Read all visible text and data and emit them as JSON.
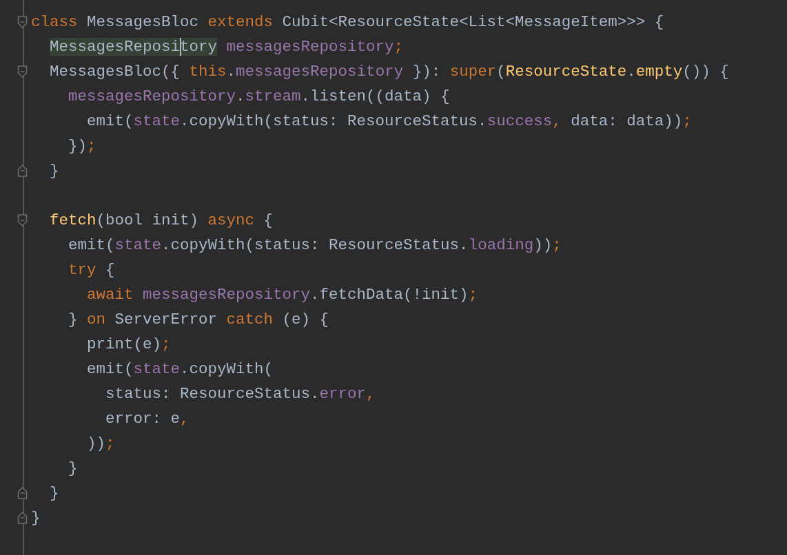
{
  "editor": {
    "lines": [
      {
        "kind": "fold-start",
        "tokens": [
          {
            "kind": "keyword",
            "text": "class"
          },
          {
            "kind": "plain",
            "text": " MessagesBloc "
          },
          {
            "kind": "keyword",
            "text": "extends"
          },
          {
            "kind": "plain",
            "text": " Cubit<ResourceState<List<MessageItem>>> {"
          }
        ]
      },
      {
        "kind": "code",
        "tokens": [
          {
            "kind": "plain",
            "text": "  MessagesReposi",
            "highlighted": true
          },
          {
            "kind": "plain",
            "text": "tory",
            "highlighted": true,
            "caret": true
          },
          {
            "kind": "field",
            "text": " messagesRepository"
          },
          {
            "kind": "keyword",
            "text": ";"
          }
        ]
      },
      {
        "kind": "fold-start",
        "tokens": [
          {
            "kind": "plain",
            "text": "  MessagesBloc({ "
          },
          {
            "kind": "keyword",
            "text": "this"
          },
          {
            "kind": "plain",
            "text": "."
          },
          {
            "kind": "field",
            "text": "messagesRepository"
          },
          {
            "kind": "plain",
            "text": " }): "
          },
          {
            "kind": "keyword",
            "text": "super"
          },
          {
            "kind": "plain",
            "text": "("
          },
          {
            "kind": "function",
            "text": "ResourceState"
          },
          {
            "kind": "plain",
            "text": "."
          },
          {
            "kind": "function",
            "text": "empty"
          },
          {
            "kind": "plain",
            "text": "()) {"
          }
        ]
      },
      {
        "kind": "code",
        "tokens": [
          {
            "kind": "field",
            "text": "    messagesRepository"
          },
          {
            "kind": "plain",
            "text": "."
          },
          {
            "kind": "field",
            "text": "stream"
          },
          {
            "kind": "plain",
            "text": ".listen((data) {"
          }
        ]
      },
      {
        "kind": "code",
        "tokens": [
          {
            "kind": "plain",
            "text": "      emit("
          },
          {
            "kind": "field",
            "text": "state"
          },
          {
            "kind": "plain",
            "text": ".copyWith(status: ResourceStatus."
          },
          {
            "kind": "field",
            "text": "success"
          },
          {
            "kind": "keyword",
            "text": ","
          },
          {
            "kind": "plain",
            "text": " data: data))"
          },
          {
            "kind": "keyword",
            "text": ";"
          }
        ]
      },
      {
        "kind": "code",
        "tokens": [
          {
            "kind": "plain",
            "text": "    })"
          },
          {
            "kind": "keyword",
            "text": ";"
          }
        ]
      },
      {
        "kind": "fold-end",
        "tokens": [
          {
            "kind": "plain",
            "text": "  }"
          }
        ]
      },
      {
        "kind": "blank"
      },
      {
        "kind": "fold-start",
        "tokens": [
          {
            "kind": "function",
            "text": "  fetch"
          },
          {
            "kind": "plain",
            "text": "(bool init) "
          },
          {
            "kind": "keyword",
            "text": "async"
          },
          {
            "kind": "plain",
            "text": " {"
          }
        ]
      },
      {
        "kind": "code",
        "tokens": [
          {
            "kind": "plain",
            "text": "    emit("
          },
          {
            "kind": "field",
            "text": "state"
          },
          {
            "kind": "plain",
            "text": ".copyWith(status: ResourceStatus."
          },
          {
            "kind": "field",
            "text": "loading"
          },
          {
            "kind": "plain",
            "text": "))"
          },
          {
            "kind": "keyword",
            "text": ";"
          }
        ]
      },
      {
        "kind": "code",
        "tokens": [
          {
            "kind": "keyword",
            "text": "    try"
          },
          {
            "kind": "plain",
            "text": " {"
          }
        ]
      },
      {
        "kind": "code",
        "tokens": [
          {
            "kind": "keyword",
            "text": "      await"
          },
          {
            "kind": "field",
            "text": " messagesRepository"
          },
          {
            "kind": "plain",
            "text": ".fetchData(!init)"
          },
          {
            "kind": "keyword",
            "text": ";"
          }
        ]
      },
      {
        "kind": "code",
        "tokens": [
          {
            "kind": "plain",
            "text": "    } "
          },
          {
            "kind": "keyword",
            "text": "on"
          },
          {
            "kind": "plain",
            "text": " ServerError "
          },
          {
            "kind": "keyword",
            "text": "catch"
          },
          {
            "kind": "plain",
            "text": " (e) {"
          }
        ]
      },
      {
        "kind": "code",
        "tokens": [
          {
            "kind": "plain",
            "text": "      print(e)"
          },
          {
            "kind": "keyword",
            "text": ";"
          }
        ]
      },
      {
        "kind": "code",
        "tokens": [
          {
            "kind": "plain",
            "text": "      emit("
          },
          {
            "kind": "field",
            "text": "state"
          },
          {
            "kind": "plain",
            "text": ".copyWith("
          }
        ]
      },
      {
        "kind": "code",
        "tokens": [
          {
            "kind": "plain",
            "text": "        status: ResourceStatus."
          },
          {
            "kind": "field",
            "text": "error"
          },
          {
            "kind": "keyword",
            "text": ","
          }
        ]
      },
      {
        "kind": "code",
        "tokens": [
          {
            "kind": "plain",
            "text": "        error: e"
          },
          {
            "kind": "keyword",
            "text": ","
          }
        ]
      },
      {
        "kind": "code",
        "tokens": [
          {
            "kind": "plain",
            "text": "      ))"
          },
          {
            "kind": "keyword",
            "text": ";"
          }
        ]
      },
      {
        "kind": "code",
        "tokens": [
          {
            "kind": "plain",
            "text": "    }"
          }
        ]
      },
      {
        "kind": "fold-end",
        "tokens": [
          {
            "kind": "plain",
            "text": "  }"
          }
        ]
      },
      {
        "kind": "fold-end",
        "tokens": [
          {
            "kind": "plain",
            "text": "}"
          }
        ]
      }
    ]
  }
}
